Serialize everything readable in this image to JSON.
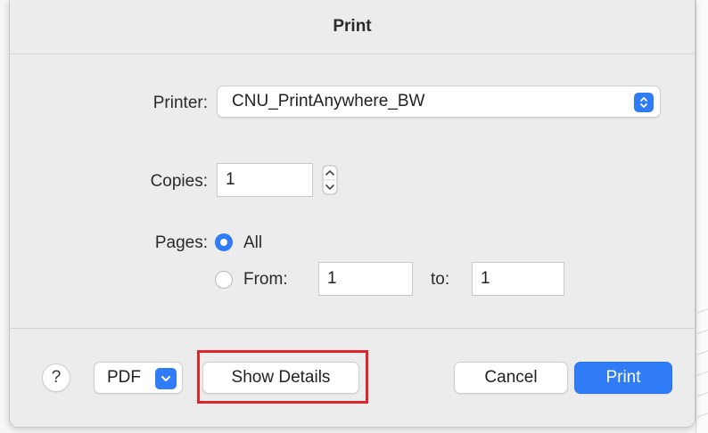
{
  "dialog": {
    "title": "Print"
  },
  "printer": {
    "label": "Printer:",
    "selected": "CNU_PrintAnywhere_BW"
  },
  "copies": {
    "label": "Copies:",
    "value": "1"
  },
  "pages": {
    "label": "Pages:",
    "all_label": "All",
    "all_selected": true,
    "from_label": "From:",
    "from_value": "1",
    "to_label": "to:",
    "to_value": "1"
  },
  "footer": {
    "help_label": "?",
    "pdf_label": "PDF",
    "details_label": "Show Details",
    "cancel_label": "Cancel",
    "print_label": "Print"
  },
  "colors": {
    "accent": "#2f7cf6",
    "highlight": "#e0262b"
  }
}
